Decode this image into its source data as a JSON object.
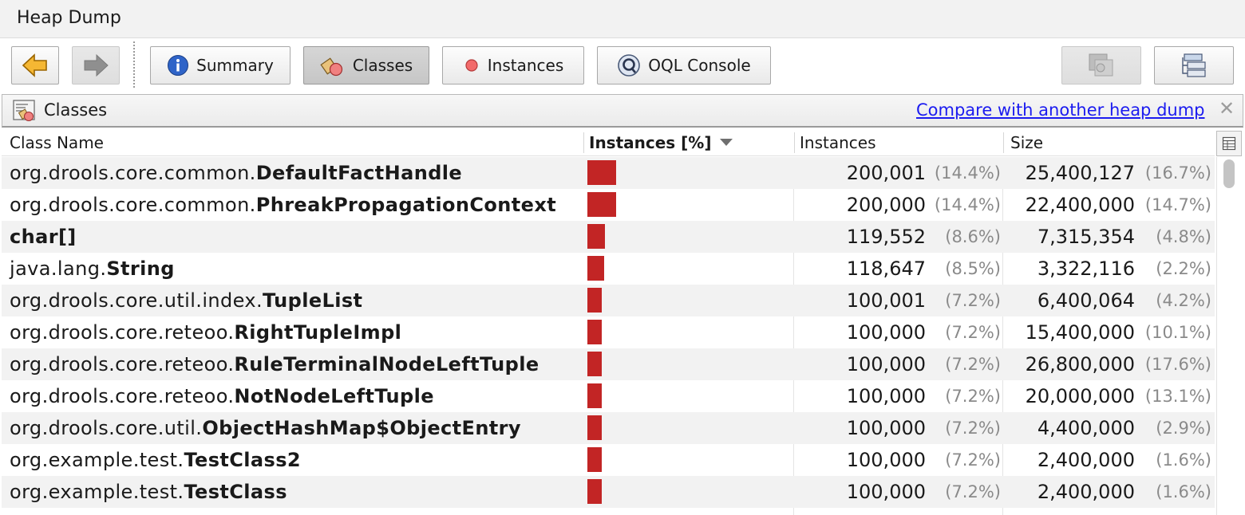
{
  "window": {
    "title": "Heap Dump"
  },
  "toolbar": {
    "back_icon": "arrow-left-icon",
    "forward_icon": "arrow-right-icon",
    "summary_label": "Summary",
    "classes_label": "Classes",
    "instances_label": "Instances",
    "oql_label": "OQL Console",
    "active_tab": "Classes",
    "accent_color": "#c22525"
  },
  "panel": {
    "title": "Classes",
    "compare_link": "Compare with another heap dump",
    "close_symbol": "✕"
  },
  "table": {
    "columns": [
      "Class Name",
      "Instances [%]",
      "Instances",
      "Size"
    ],
    "sorted_column": "Instances [%]",
    "rows": [
      {
        "pkg": "org.drools.core.common.",
        "cls": "DefaultFactHandle",
        "share": 0.144,
        "instances": "200,001",
        "instances_pct": "(14.4%)",
        "size": "25,400,127",
        "size_pct": "(16.7%)"
      },
      {
        "pkg": "org.drools.core.common.",
        "cls": "PhreakPropagationContext",
        "share": 0.144,
        "instances": "200,000",
        "instances_pct": "(14.4%)",
        "size": "22,400,000",
        "size_pct": "(14.7%)"
      },
      {
        "pkg": "",
        "cls": "char[]",
        "share": 0.086,
        "instances": "119,552",
        "instances_pct": "(8.6%)",
        "size": "7,315,354",
        "size_pct": "(4.8%)"
      },
      {
        "pkg": "java.lang.",
        "cls": "String",
        "share": 0.085,
        "instances": "118,647",
        "instances_pct": "(8.5%)",
        "size": "3,322,116",
        "size_pct": "(2.2%)"
      },
      {
        "pkg": "org.drools.core.util.index.",
        "cls": "TupleList",
        "share": 0.072,
        "instances": "100,001",
        "instances_pct": "(7.2%)",
        "size": "6,400,064",
        "size_pct": "(4.2%)"
      },
      {
        "pkg": "org.drools.core.reteoo.",
        "cls": "RightTupleImpl",
        "share": 0.072,
        "instances": "100,000",
        "instances_pct": "(7.2%)",
        "size": "15,400,000",
        "size_pct": "(10.1%)"
      },
      {
        "pkg": "org.drools.core.reteoo.",
        "cls": "RuleTerminalNodeLeftTuple",
        "share": 0.072,
        "instances": "100,000",
        "instances_pct": "(7.2%)",
        "size": "26,800,000",
        "size_pct": "(17.6%)"
      },
      {
        "pkg": "org.drools.core.reteoo.",
        "cls": "NotNodeLeftTuple",
        "share": 0.072,
        "instances": "100,000",
        "instances_pct": "(7.2%)",
        "size": "20,000,000",
        "size_pct": "(13.1%)"
      },
      {
        "pkg": "org.drools.core.util.",
        "cls": "ObjectHashMap$ObjectEntry",
        "share": 0.072,
        "instances": "100,000",
        "instances_pct": "(7.2%)",
        "size": "4,400,000",
        "size_pct": "(2.9%)"
      },
      {
        "pkg": "org.example.test.",
        "cls": "TestClass2",
        "share": 0.072,
        "instances": "100,000",
        "instances_pct": "(7.2%)",
        "size": "2,400,000",
        "size_pct": "(1.6%)"
      },
      {
        "pkg": "org.example.test.",
        "cls": "TestClass",
        "share": 0.072,
        "instances": "100,000",
        "instances_pct": "(7.2%)",
        "size": "2,400,000",
        "size_pct": "(1.6%)"
      }
    ]
  }
}
